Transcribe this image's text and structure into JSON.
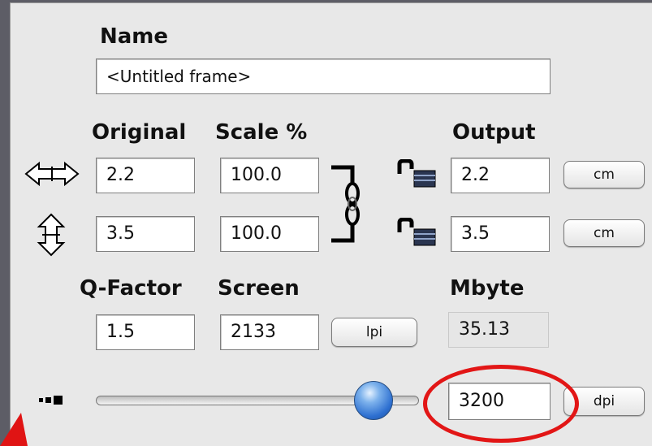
{
  "colors": {
    "background": "#5d5d66",
    "panel": "#e8e8e8",
    "highlight": "#e21616",
    "slider_thumb": "#2d6fd0"
  },
  "name": {
    "label": "Name",
    "value": "<Untitled frame>"
  },
  "columns": {
    "original": "Original",
    "scale": "Scale %",
    "output": "Output"
  },
  "width_row": {
    "icon": "horizontal-arrows-icon",
    "original": "2.2",
    "scale": "100.0",
    "output": "2.2",
    "unit": "cm"
  },
  "height_row": {
    "icon": "vertical-arrows-icon",
    "original": "3.5",
    "scale": "100.0",
    "output": "3.5",
    "unit": "cm"
  },
  "icons": {
    "chain": "chain-link-icon",
    "lock": "unlocked-padlock-icon",
    "small_large": "size-scale-icon"
  },
  "qfactor": {
    "label": "Q-Factor",
    "value": "1.5"
  },
  "screen": {
    "label": "Screen",
    "value": "2133",
    "unit": "lpi"
  },
  "mbyte": {
    "label": "Mbyte",
    "value": "35.13"
  },
  "resolution": {
    "value": "3200",
    "unit": "dpi",
    "slider_fraction": 0.84
  }
}
